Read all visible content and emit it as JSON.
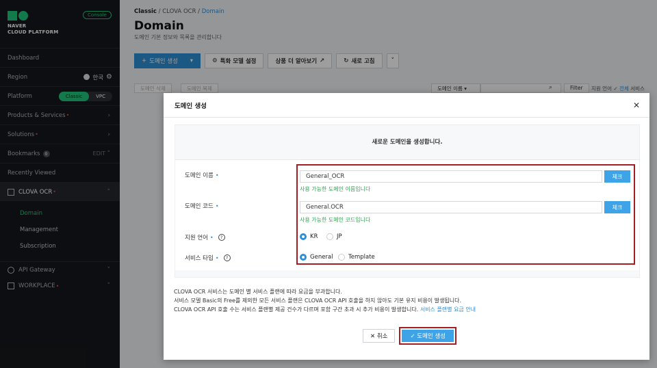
{
  "sidebar": {
    "brand_line1": "NAVER",
    "brand_line2": "CLOUD PLATFORM",
    "console_badge": "Console",
    "dashboard": "Dashboard",
    "region_label": "Region",
    "region_value": "한국",
    "platform_label": "Platform",
    "platform_classic": "Classic",
    "platform_vpc": "VPC",
    "products": "Products & Services",
    "solutions": "Solutions",
    "bookmarks": "Bookmarks",
    "bookmarks_count": "0",
    "bookmarks_edit": "EDIT",
    "recently_viewed": "Recently Viewed",
    "clova_ocr": "CLOVA OCR",
    "sub_items": [
      "Domain",
      "Management",
      "Subscription"
    ],
    "api_gateway": "API Gateway",
    "workplace": "WORKPLACE"
  },
  "header": {
    "crumb1": "Classic",
    "crumb2": "CLOVA OCR",
    "crumb3": "Domain",
    "title": "Domain",
    "subtitle": "도메인 기본 정보와 목록을 관리합니다"
  },
  "toolbar": {
    "create": "도메인 생성",
    "special_model": "특화 모델 설정",
    "learn_more": "상품 더 알아보기",
    "refresh": "새로 고침"
  },
  "behind": {
    "btn1": "도메인 삭제",
    "btn2": "도메인 복제",
    "search_select": "도메인 이름",
    "filter": "Filter",
    "lang_filter": "지원 언어",
    "all": "전체",
    "service": "서비스"
  },
  "modal": {
    "title": "도메인 생성",
    "intro": "새로운 도메인을 생성합니다.",
    "name_label": "도메인 이름",
    "name_value": "General_OCR",
    "name_ok": "사용 가능한 도메인 이름입니다",
    "code_label": "도메인 코드",
    "code_value": "General.OCR",
    "code_ok": "사용 가능한 도메인 코드입니다",
    "check": "체크",
    "lang_label": "지원 언어",
    "lang_kr": "KR",
    "lang_jp": "JP",
    "type_label": "서비스 타입",
    "type_general": "General",
    "type_template": "Template",
    "note1": "CLOVA OCR 서비스는 도메인 별 서비스 플랜에 따라 요금을 부과합니다.",
    "note2": "서비스 모델 Basic의 Free를 제외한 모든 서비스 플랜은 CLOVA OCR API 호출을 하지 않아도 기본 유지 비용이 발생됩니다.",
    "note3": "CLOVA OCR API 호출 수는 서비스 플랜별 제공 건수가 다르며 포함 구간 초과 시 추가 비용이 발생합니다.",
    "note3_link": "서비스 플랜별 요금 안내",
    "cancel": "취소",
    "create": "도메인 생성"
  }
}
